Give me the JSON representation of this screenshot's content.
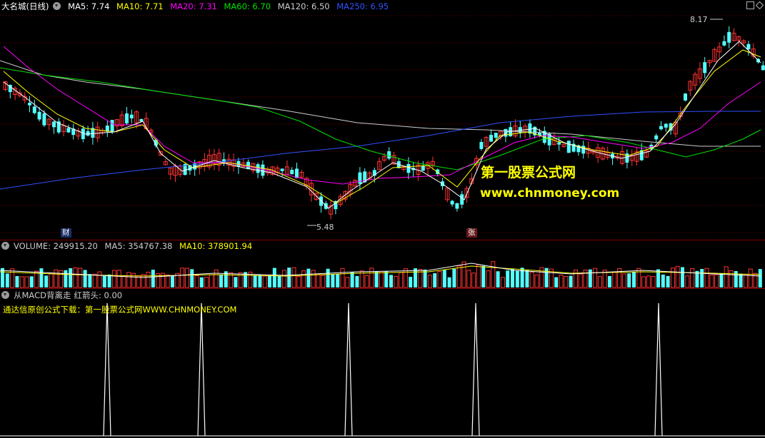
{
  "price": {
    "stock_title": "大名城(日线)",
    "ma_legend": [
      {
        "label": "MA5: 7.74",
        "color": "#ffffff"
      },
      {
        "label": "MA10: 7.71",
        "color": "#ffff00"
      },
      {
        "label": "MA20: 7.31",
        "color": "#ff00ff"
      },
      {
        "label": "MA60: 6.70",
        "color": "#00e000"
      },
      {
        "label": "MA120: 6.50",
        "color": "#cccccc"
      },
      {
        "label": "MA250: 6.95",
        "color": "#3050ff"
      }
    ],
    "high_label": "8.17",
    "low_label": "5.48",
    "tag_cai": "财",
    "tag_zhang": "张",
    "watermark_cn": "第一股票公式网",
    "watermark_url": "www.chnmoney.com"
  },
  "volume": {
    "legend": [
      {
        "label": "VOLUME: 249915.20",
        "color": "#cccccc"
      },
      {
        "label": "MA5: 354767.38",
        "color": "#cccccc"
      },
      {
        "label": "MA10: 378901.94",
        "color": "#ffff00"
      }
    ]
  },
  "indicator": {
    "title": "从MACD背离走",
    "subtitle": "红箭头: 0.00",
    "download_note": "通达信原创公式下载：第一股票公式网WWW.CHNMONEY.COM"
  },
  "colors": {
    "up": "#ff3232",
    "down": "#54ffff",
    "grid": "#800000"
  }
}
